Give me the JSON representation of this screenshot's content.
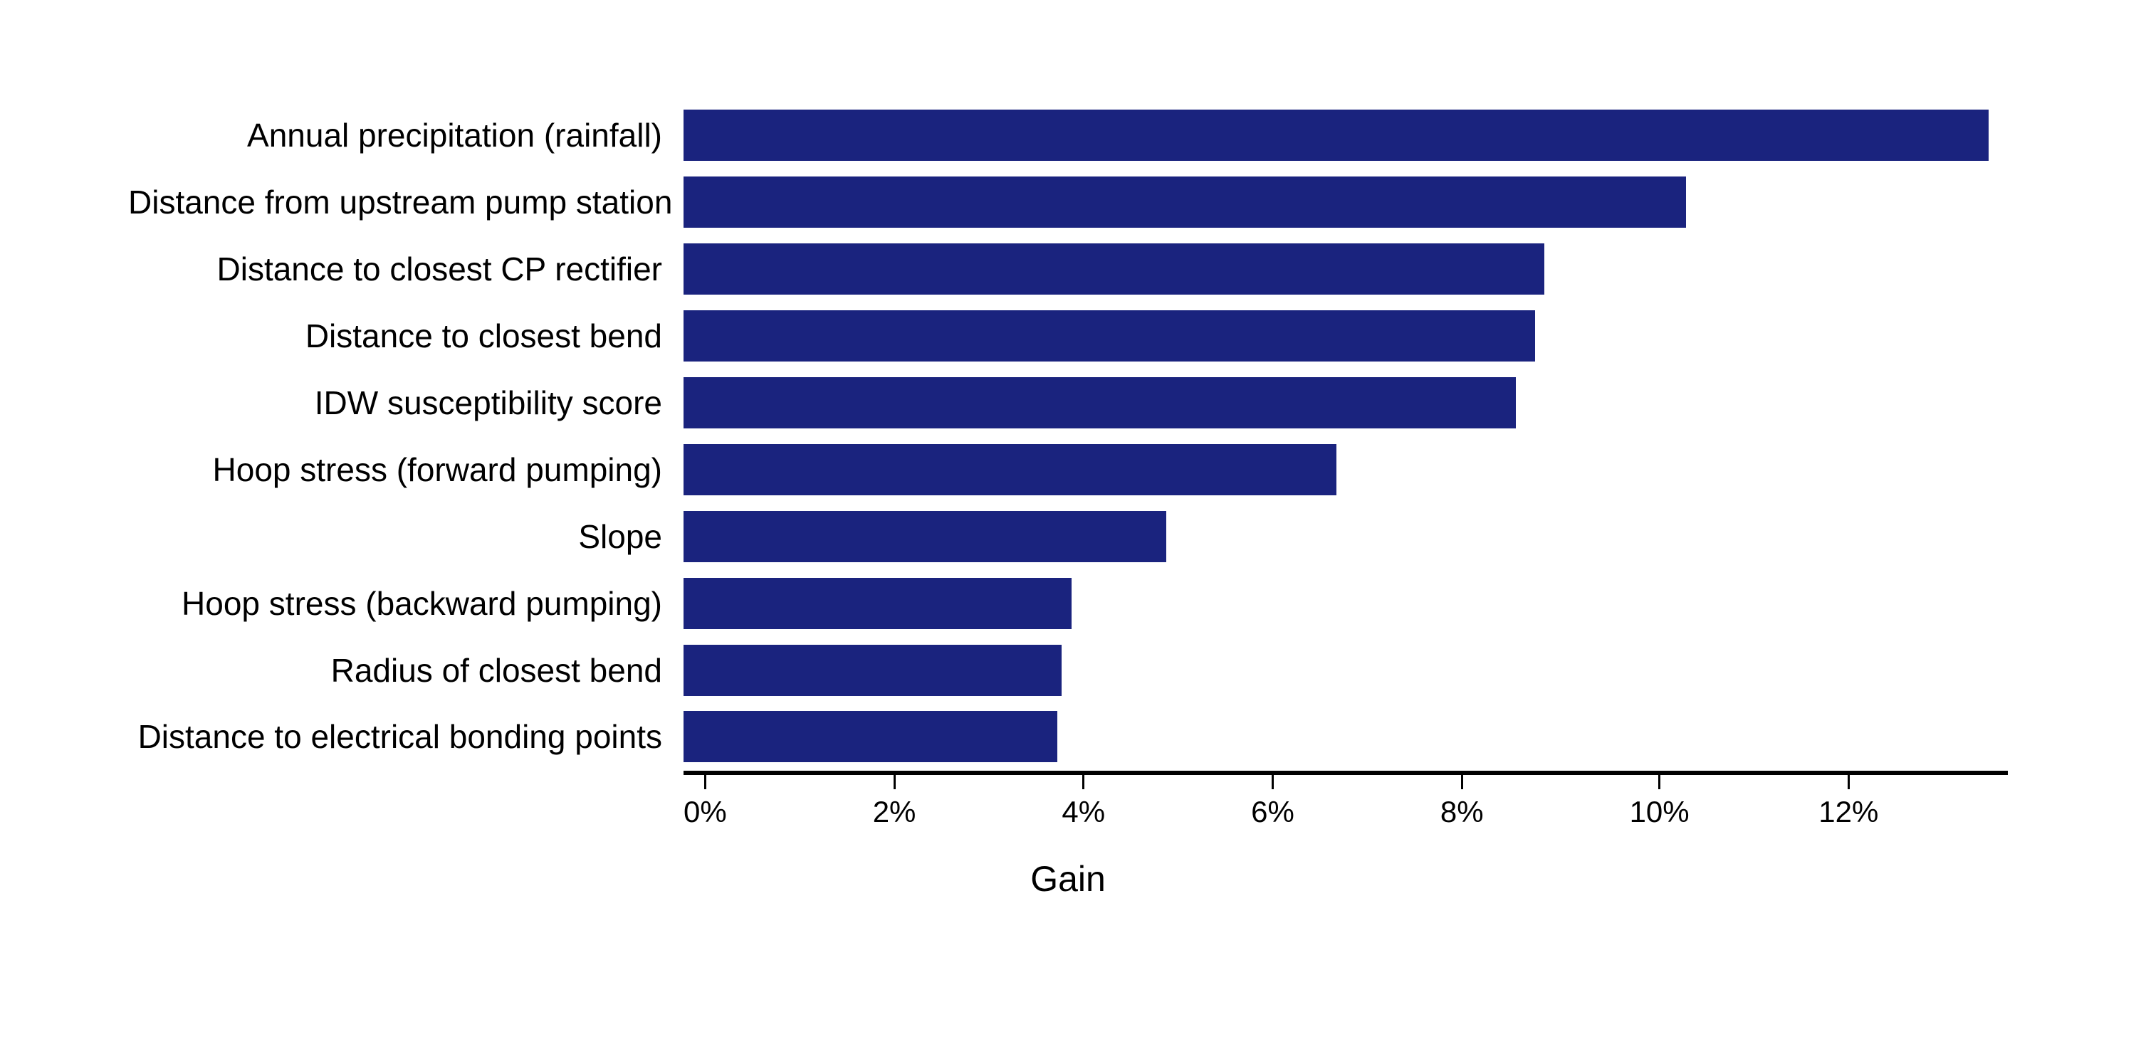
{
  "chart": {
    "title": "",
    "x_axis_label": "Gain",
    "bar_color": "#1a237e",
    "max_value": 14,
    "ticks": [
      {
        "label": "0%",
        "value": 0
      },
      {
        "label": "2%",
        "value": 2
      },
      {
        "label": "4%",
        "value": 4
      },
      {
        "label": "6%",
        "value": 6
      },
      {
        "label": "8%",
        "value": 8
      },
      {
        "label": "10%",
        "value": 10
      },
      {
        "label": "12%",
        "value": 12
      }
    ],
    "bars": [
      {
        "label": "Annual precipitation (rainfall)",
        "value": 13.8
      },
      {
        "label": "Distance from upstream pump station",
        "value": 10.6
      },
      {
        "label": "Distance to closest CP rectifier",
        "value": 9.1
      },
      {
        "label": "Distance to closest bend",
        "value": 9.0
      },
      {
        "label": "IDW susceptibility score",
        "value": 8.8
      },
      {
        "label": "Hoop stress (forward pumping)",
        "value": 6.9
      },
      {
        "label": "Slope",
        "value": 5.1
      },
      {
        "label": "Hoop stress (backward pumping)",
        "value": 4.1
      },
      {
        "label": "Radius of closest bend",
        "value": 4.0
      },
      {
        "label": "Distance to electrical bonding points",
        "value": 3.95
      }
    ]
  }
}
